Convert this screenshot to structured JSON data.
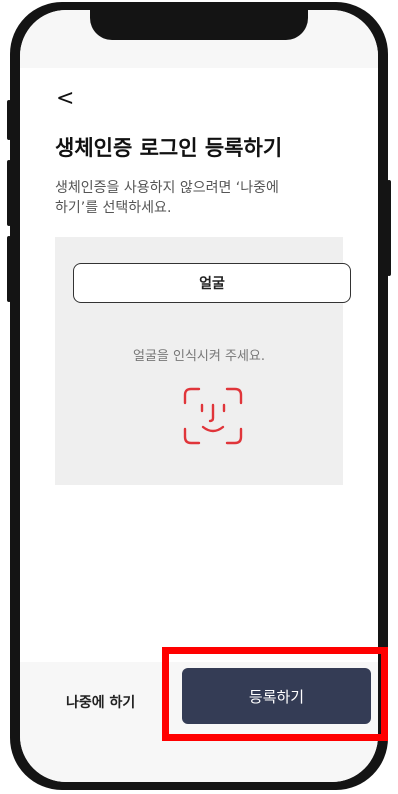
{
  "colors": {
    "frame": "#141414",
    "primary_button": "#343c55",
    "face_icon": "#e0353a",
    "highlight": "#ff0000"
  },
  "header": {
    "back_icon": "chevron-left-icon",
    "back_glyph": "<"
  },
  "main": {
    "title": "생체인증 로그인 등록하기",
    "description_line1": "생체인증을 사용하지 않으려면 ‘나중에",
    "description_line2": "하기’를 선택하세요.",
    "method_tab_label": "얼굴",
    "prompt": "얼굴을 인식시켜 주세요.",
    "face_icon": "face-id-icon"
  },
  "footer": {
    "later_label": "나중에 하기",
    "register_label": "등록하기"
  }
}
